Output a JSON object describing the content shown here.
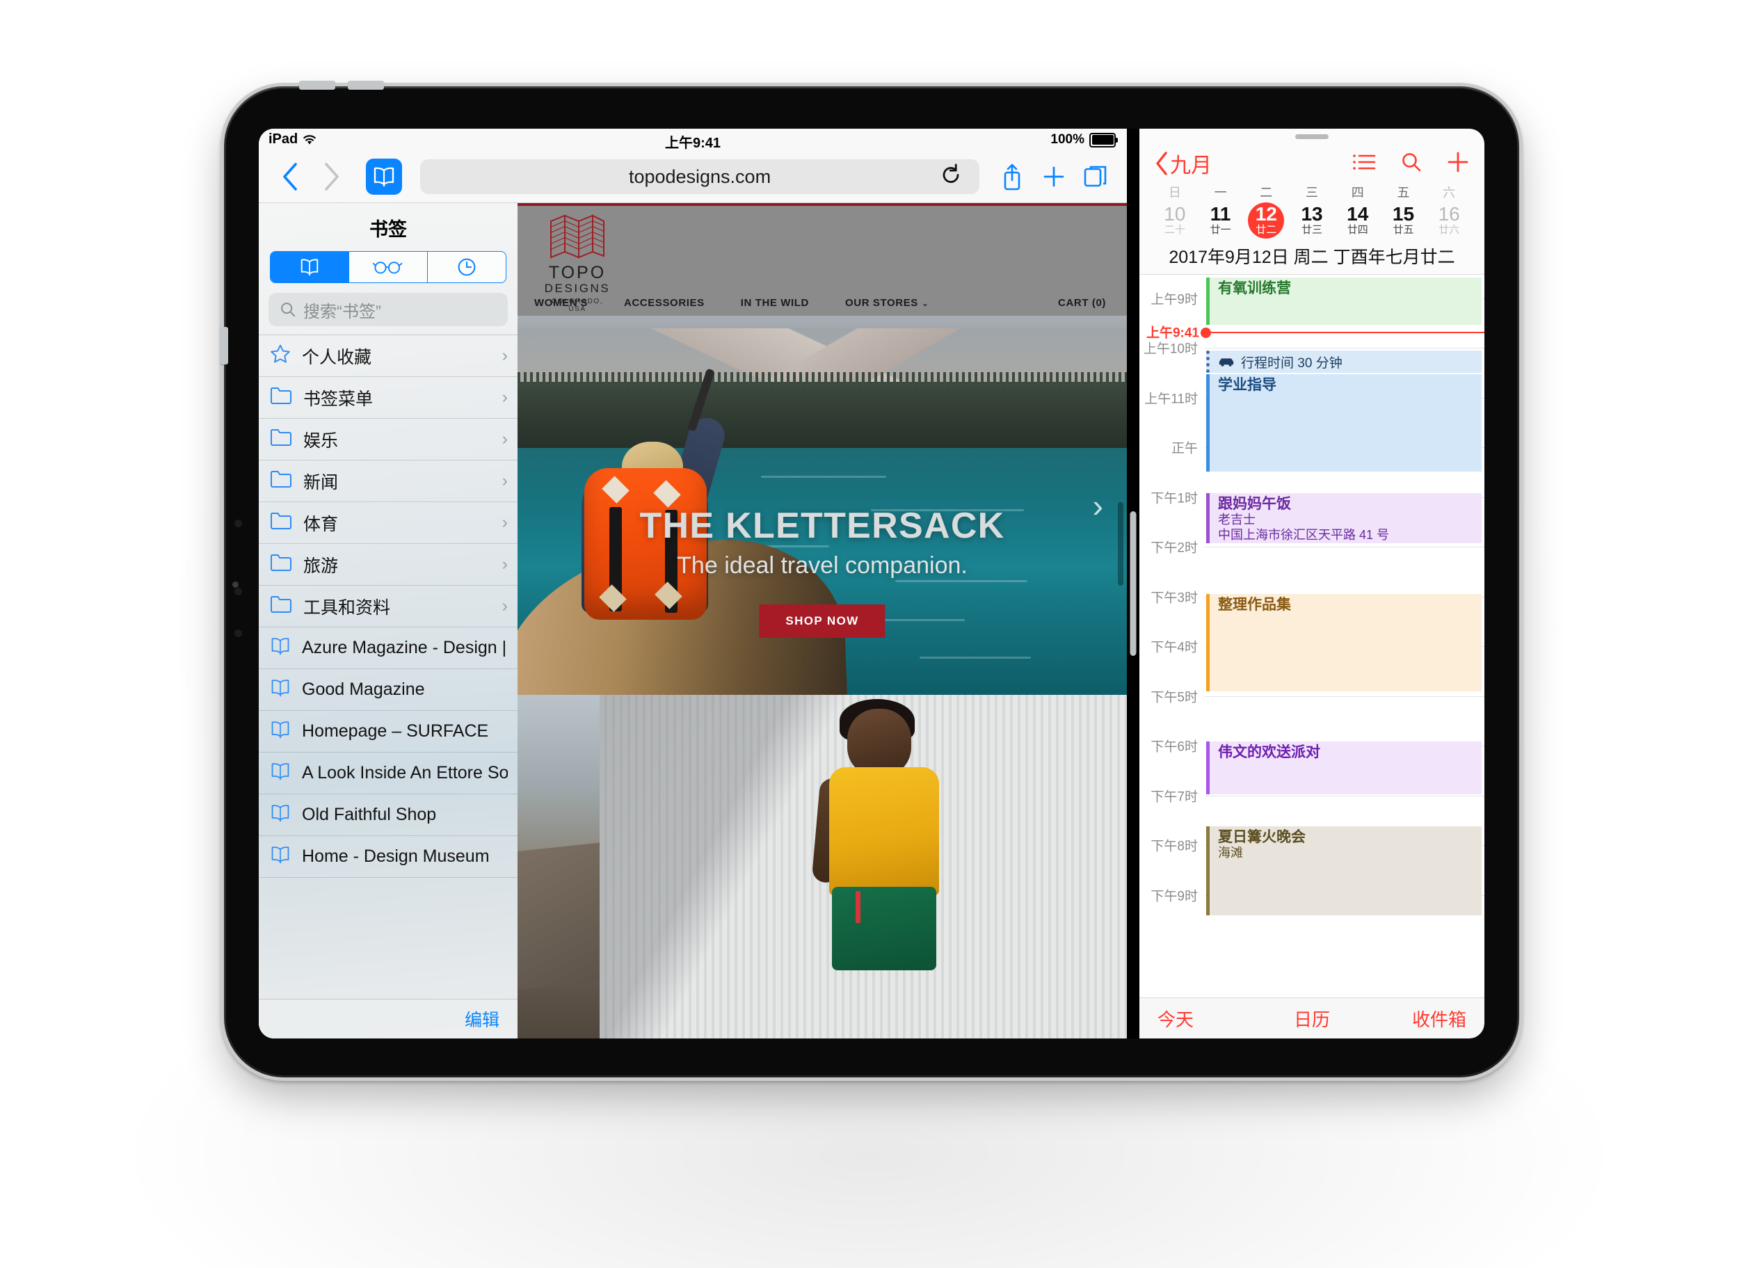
{
  "status_bar": {
    "device": "iPad",
    "wifi_icon": "wifi-icon",
    "time": "上午9:41",
    "battery_percent": "100%"
  },
  "safari": {
    "toolbar": {
      "back_icon": "chevron-left-icon",
      "forward_icon": "chevron-right-icon",
      "bookmarks_icon": "book-icon",
      "url": "topodesigns.com",
      "reload_icon": "reload-icon",
      "share_icon": "share-icon",
      "newtab_icon": "plus-icon",
      "tabs_icon": "tabs-icon"
    },
    "sidebar": {
      "title": "书签",
      "segments": [
        {
          "name": "bookmarks",
          "icon": "book-icon",
          "active": true
        },
        {
          "name": "reading-list",
          "icon": "glasses-icon",
          "active": false
        },
        {
          "name": "history",
          "icon": "clock-icon",
          "active": false
        }
      ],
      "search_placeholder": "搜索“书签”",
      "items": [
        {
          "label": "个人收藏",
          "icon": "star-icon",
          "chevron": "›"
        },
        {
          "label": "书签菜单",
          "icon": "folder-icon",
          "chevron": "›"
        },
        {
          "label": "娱乐",
          "icon": "folder-icon",
          "chevron": "›"
        },
        {
          "label": "新闻",
          "icon": "folder-icon",
          "chevron": "›"
        },
        {
          "label": "体育",
          "icon": "folder-icon",
          "chevron": "›"
        },
        {
          "label": "旅游",
          "icon": "folder-icon",
          "chevron": "›"
        },
        {
          "label": "工具和资料",
          "icon": "folder-icon",
          "chevron": "›"
        },
        {
          "label": "Azure Magazine - Design | Arc…",
          "icon": "bookmark-icon",
          "chevron": ""
        },
        {
          "label": "Good Magazine",
          "icon": "bookmark-icon",
          "chevron": ""
        },
        {
          "label": "Homepage – SURFACE",
          "icon": "bookmark-icon",
          "chevron": ""
        },
        {
          "label": "A Look Inside An Ettore Sottsa…",
          "icon": "bookmark-icon",
          "chevron": ""
        },
        {
          "label": "Old Faithful Shop",
          "icon": "bookmark-icon",
          "chevron": ""
        },
        {
          "label": "Home - Design Museum",
          "icon": "bookmark-icon",
          "chevron": ""
        }
      ],
      "edit_label": "编辑"
    },
    "webpage": {
      "logo": {
        "name": "TOPO",
        "designs": "DESIGNS",
        "location": "COLORADO, USA"
      },
      "nav": [
        "WOMEN'S",
        "ACCESSORIES",
        "IN THE WILD",
        "OUR STORES"
      ],
      "nav_caret": "⌄",
      "cart": "CART (0)",
      "hero": {
        "title": "THE KLETTERSACK",
        "subtitle": "The ideal travel companion.",
        "cta": "SHOP NOW",
        "next_arrow": "›"
      }
    }
  },
  "calendar": {
    "back_label": "九月",
    "back_icon": "chevron-left-icon",
    "actions": [
      {
        "name": "list-view",
        "icon": "list-icon"
      },
      {
        "name": "search",
        "icon": "search-icon"
      },
      {
        "name": "add-event",
        "icon": "plus-icon"
      }
    ],
    "weekday_headers": [
      "日",
      "一",
      "二",
      "三",
      "四",
      "五",
      "六"
    ],
    "days": [
      {
        "num": "10",
        "lunar": "二十",
        "dim": true,
        "today": false
      },
      {
        "num": "11",
        "lunar": "廿一",
        "dim": false,
        "today": false
      },
      {
        "num": "12",
        "lunar": "廿二",
        "dim": false,
        "today": true
      },
      {
        "num": "13",
        "lunar": "廿三",
        "dim": false,
        "today": false
      },
      {
        "num": "14",
        "lunar": "廿四",
        "dim": false,
        "today": false
      },
      {
        "num": "15",
        "lunar": "廿五",
        "dim": false,
        "today": false
      },
      {
        "num": "16",
        "lunar": "廿六",
        "dim": true,
        "today": false
      }
    ],
    "full_date": "2017年9月12日 周二  丁酉年七月廿二",
    "hour_labels": [
      "上午9时",
      "上午10时",
      "上午11时",
      "正午",
      "下午1时",
      "下午2时",
      "下午3时",
      "下午4时",
      "下午5时",
      "下午6时",
      "下午7时",
      "下午8时",
      "下午9时"
    ],
    "now_label": "上午9:41",
    "travel": {
      "icon": "car-icon",
      "text": "行程时间 30 分钟"
    },
    "events": [
      {
        "title": "有氧训练营",
        "sub": "",
        "sub2": "",
        "color": "#4cc558",
        "bg": "#e2f5e0",
        "text": "#27792f"
      },
      {
        "title": "学业指导",
        "sub": "",
        "sub2": "",
        "color": "#3a8ee0",
        "bg": "#d4e7f8",
        "text": "#1d4d80"
      },
      {
        "title": "跟妈妈午饭",
        "sub": "老吉士",
        "sub2": "中国上海市徐汇区天平路 41 号",
        "color": "#9a4fd0",
        "bg": "#f0e3fa",
        "text": "#6b2aa0"
      },
      {
        "title": "整理作品集",
        "sub": "",
        "sub2": "",
        "color": "#f5a11e",
        "bg": "#fceed9",
        "text": "#8a5a12"
      },
      {
        "title": "伟文的欢送派对",
        "sub": "",
        "sub2": "",
        "color": "#a855e8",
        "bg": "#f2e4fb",
        "text": "#6d1fb0"
      },
      {
        "title": "夏日篝火晚会",
        "sub": "海滩",
        "sub2": "",
        "color": "#8a7a3e",
        "bg": "#e8e4dc",
        "text": "#5c4f22"
      }
    ],
    "toolbar": [
      "今天",
      "日历",
      "收件箱"
    ]
  },
  "colors": {
    "ios_blue": "#0a84ff",
    "ios_red": "#ff3b30",
    "topo_red": "#a61b25"
  }
}
